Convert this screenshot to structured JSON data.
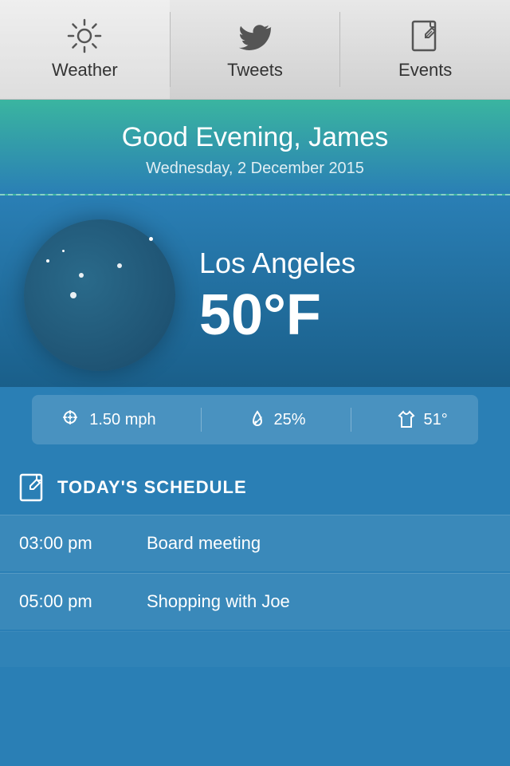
{
  "tabs": [
    {
      "id": "weather",
      "label": "Weather",
      "icon": "sun",
      "active": true
    },
    {
      "id": "tweets",
      "label": "Tweets",
      "icon": "twitter",
      "active": false
    },
    {
      "id": "events",
      "label": "Events",
      "icon": "pencil",
      "active": false
    }
  ],
  "greeting": {
    "text": "Good Evening, James",
    "date": "Wednesday, 2 December 2015"
  },
  "weather": {
    "city": "Los Angeles",
    "temperature": "50°F",
    "condition": "clear night"
  },
  "stats": {
    "wind": "1.50 mph",
    "humidity": "25%",
    "feels_like": "51°"
  },
  "schedule": {
    "title": "TODAY'S SCHEDULE",
    "events": [
      {
        "time": "03:00 pm",
        "event": "Board meeting"
      },
      {
        "time": "05:00 pm",
        "event": "Shopping with Joe"
      }
    ]
  }
}
